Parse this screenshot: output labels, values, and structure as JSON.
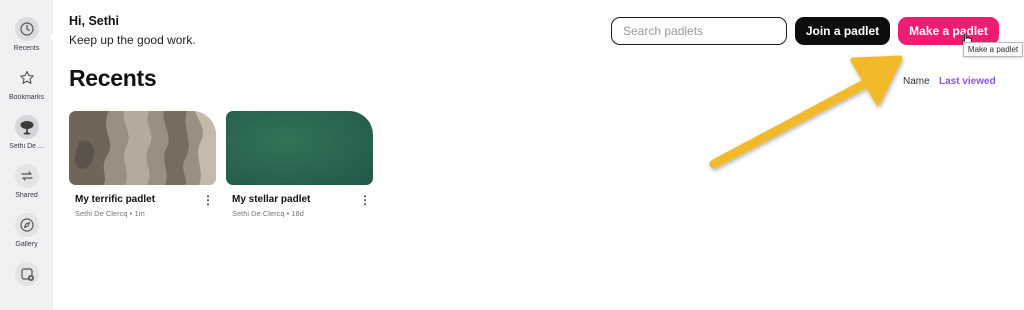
{
  "sidebar": {
    "items": [
      {
        "label": "Recents",
        "icon": "clock-icon"
      },
      {
        "label": "Bookmarks",
        "icon": "star-icon"
      },
      {
        "label": "Sethi De ...",
        "icon": "avatar-icon"
      },
      {
        "label": "Shared",
        "icon": "shared-arrows-icon"
      },
      {
        "label": "Gallery",
        "icon": "compass-icon"
      },
      {
        "label": "",
        "icon": "add-folder-icon"
      }
    ]
  },
  "header": {
    "greeting": "Hi, Sethi",
    "subtitle": "Keep up the good work.",
    "search_placeholder": "Search padlets",
    "join_label": "Join a padlet",
    "make_label": "Make a padlet",
    "tooltip": "Make a padlet"
  },
  "main": {
    "section_title": "Recents",
    "sort": {
      "name_label": "Name",
      "last_viewed_label": "Last viewed",
      "active": "Last viewed"
    },
    "cards": [
      {
        "title": "My terrific padlet",
        "author": "Sethi De Clercq",
        "time": "1m",
        "meta": "Sethi De Clercq • 1m"
      },
      {
        "title": "My stellar padlet",
        "author": "Sethi De Clercq",
        "time": "18d",
        "meta": "Sethi De Clercq • 18d"
      }
    ]
  },
  "colors": {
    "accent_pink": "#ee1d72",
    "dark_button": "#0d0d0f",
    "active_sort": "#8e55e0",
    "annotation_arrow": "#f2b92a",
    "card_green": "#2b6a50"
  }
}
